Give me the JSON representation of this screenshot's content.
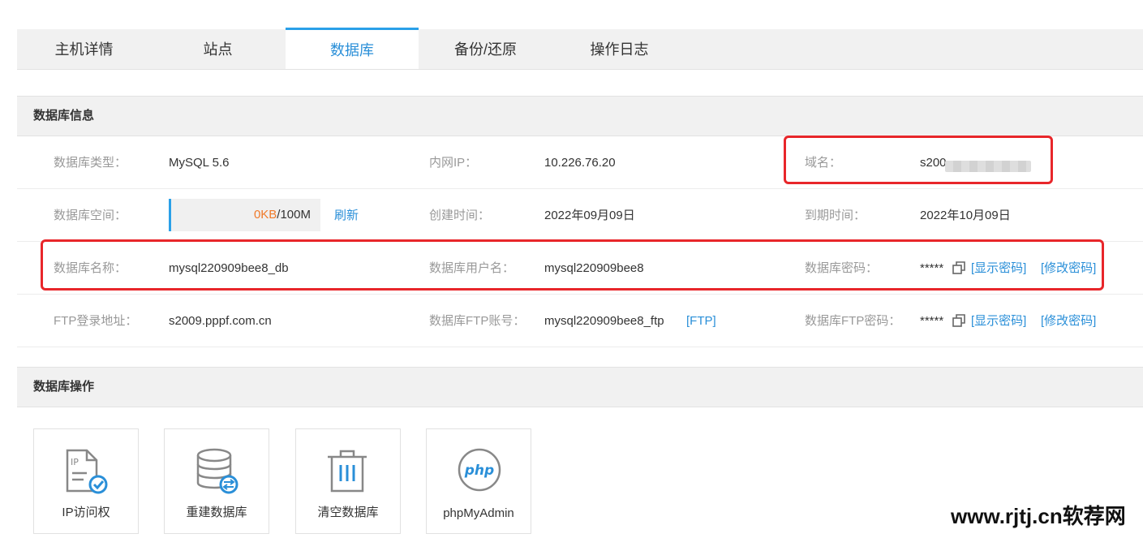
{
  "tabs": [
    {
      "label": "主机详情"
    },
    {
      "label": "站点"
    },
    {
      "label": "数据库"
    },
    {
      "label": "备份/还原"
    },
    {
      "label": "操作日志"
    }
  ],
  "active_tab": "数据库",
  "db_info": {
    "title": "数据库信息",
    "type_label": "数据库类型：",
    "type_value": "MySQL 5.6",
    "intranet_ip_label": "内网IP：",
    "intranet_ip_value": "10.226.76.20",
    "domain_label": "域名：",
    "domain_value": "s200",
    "space_label": "数据库空间：",
    "space_used": "0KB",
    "space_total": "/100M",
    "refresh_link": "刷新",
    "created_label": "创建时间：",
    "created_value": "2022年09月09日",
    "expire_label": "到期时间：",
    "expire_value": "2022年10月09日",
    "name_label": "数据库名称：",
    "name_value": "mysql220909bee8_db",
    "user_label": "数据库用户名：",
    "user_value": "mysql220909bee8",
    "password_label": "数据库密码：",
    "password_masked": "*****",
    "show_password_link": "[显示密码]",
    "change_password_link": "[修改密码]",
    "ftp_addr_label": "FTP登录地址：",
    "ftp_addr_value": "s2009.pppf.com.cn",
    "ftp_account_label": "数据库FTP账号：",
    "ftp_account_value": "mysql220909bee8_ftp",
    "ftp_link": "[FTP]",
    "ftp_password_label": "数据库FTP密码：",
    "ftp_password_masked": "*****",
    "ftp_show_password_link": "[显示密码]",
    "ftp_change_password_link": "[修改密码]"
  },
  "db_ops": {
    "title": "数据库操作",
    "cards": [
      {
        "label": "IP访问权",
        "icon": "ip-access-icon"
      },
      {
        "label": "重建数据库",
        "icon": "database-rebuild-icon"
      },
      {
        "label": "清空数据库",
        "icon": "trash-icon"
      },
      {
        "label": "phpMyAdmin",
        "icon": "php-icon",
        "icon_text": "php"
      }
    ]
  },
  "watermark": "www.rjtj.cn软荐网",
  "colors": {
    "accent": "#2a8fd8",
    "used_space": "#f07a2a",
    "highlight_box": "#e8262a",
    "label_gray": "#999999"
  }
}
